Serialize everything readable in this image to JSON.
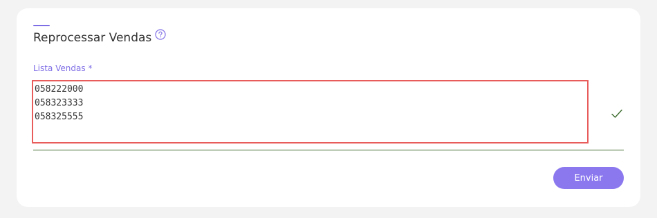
{
  "form": {
    "title": "Reprocessar Vendas",
    "help_icon": "question-circle-icon",
    "field_label": "Lista Vendas *",
    "textarea_lines": [
      "058222000",
      "058323333",
      "058325555"
    ],
    "valid_icon": "checkmark-icon",
    "submit_label": "Enviar"
  },
  "colors": {
    "accent": "#7e6ee6",
    "button": "#8b78ef",
    "highlight_border": "#e85c5c",
    "valid": "#3c6b2c"
  }
}
